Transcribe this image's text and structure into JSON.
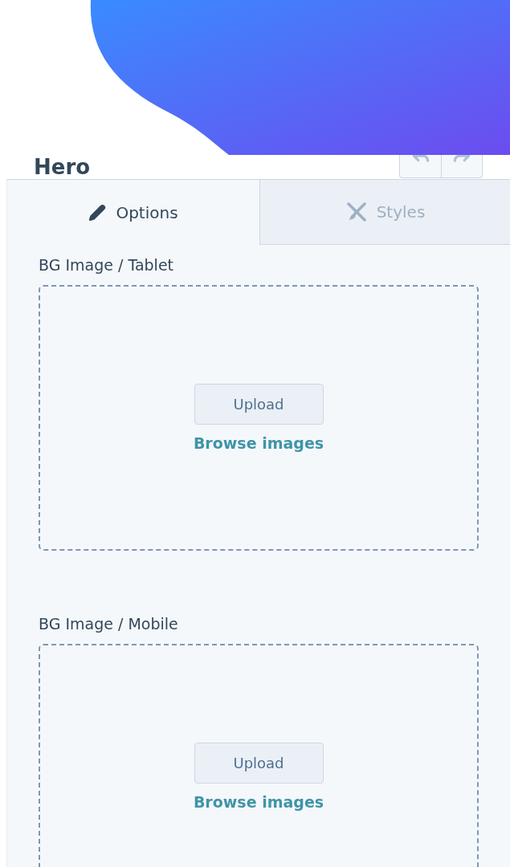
{
  "panel": {
    "title": "Hero"
  },
  "tabs": [
    {
      "label": "Options",
      "kind": "pencil",
      "selected": true
    },
    {
      "label": "Styles",
      "kind": "brush",
      "selected": false
    }
  ],
  "fields": [
    {
      "label": "BG Image / Tablet",
      "button": "Upload",
      "link": "Browse images"
    },
    {
      "label": "BG Image / Mobile",
      "button": "Upload",
      "link": "Browse images"
    }
  ]
}
